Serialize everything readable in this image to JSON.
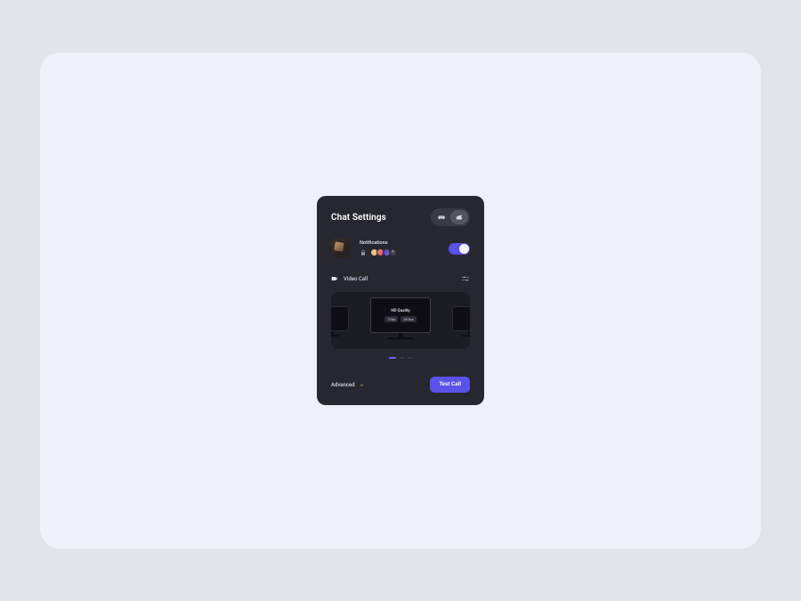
{
  "header": {
    "title": "Chat Settings",
    "segments": [
      {
        "icon": "game-controller-icon",
        "active": false
      },
      {
        "icon": "cloud-moon-icon",
        "active": true
      }
    ]
  },
  "notifications": {
    "label": "Notifications",
    "more_count": "+",
    "toggle_on": true
  },
  "video": {
    "label": "Video Call",
    "center": {
      "title": "HD Quality",
      "chips": [
        "720p",
        "30 fps"
      ]
    }
  },
  "footer": {
    "advanced_label": "Advanced",
    "cta_label": "Test Call"
  }
}
